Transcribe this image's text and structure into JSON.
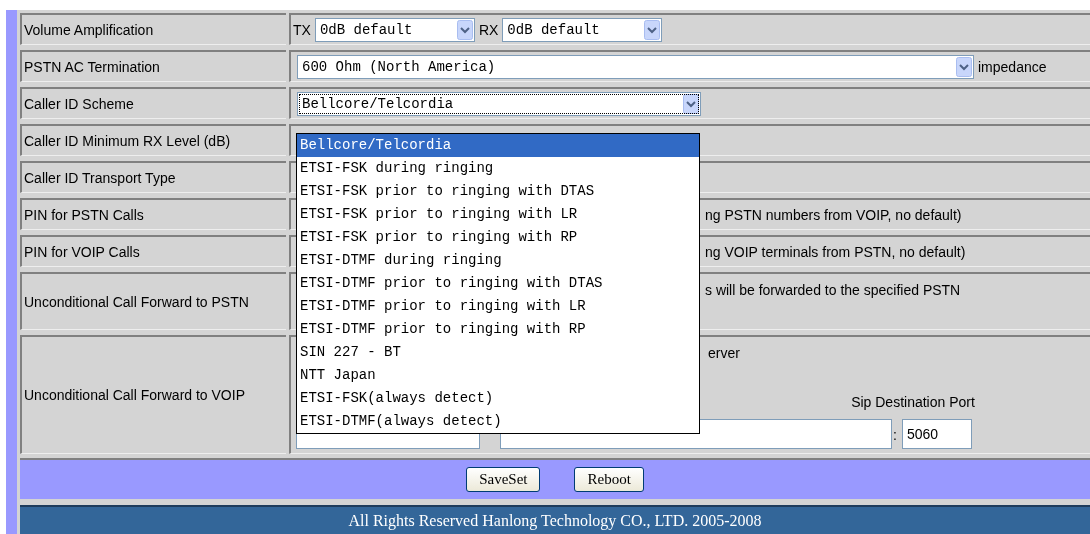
{
  "rows": [
    {
      "kind": "dual_select",
      "label": "Volume Amplification",
      "tx_label": "TX",
      "tx_value": "0dB default",
      "rx_label": "RX",
      "rx_value": "0dB default"
    },
    {
      "kind": "select_unit",
      "label": "PSTN AC Termination",
      "value": "600 Ohm (North America)",
      "unit": "impedance"
    },
    {
      "kind": "select_open",
      "label": "Caller ID Scheme",
      "value": "Bellcore/Telcordia"
    },
    {
      "kind": "blank",
      "label": "Caller ID Minimum RX Level (dB)"
    },
    {
      "kind": "blank",
      "label": "Caller ID Transport Type"
    },
    {
      "kind": "note",
      "label": "PIN for PSTN Calls",
      "note": "ng PSTN numbers from VOIP, no default)"
    },
    {
      "kind": "note",
      "label": "PIN for VOIP Calls",
      "note": "ng VOIP terminals from PSTN, no default)"
    },
    {
      "kind": "note_tall",
      "label": "Unconditional Call Forward to PSTN",
      "note": "s will be forwarded to the specified PSTN"
    },
    {
      "kind": "voip_forward",
      "label": "Unconditional Call Forward to VOIP",
      "server_label": "erver",
      "port_label": "Sip Destination Port",
      "separator": ":",
      "port_value": "5060"
    }
  ],
  "dropdown": {
    "options": [
      {
        "label": "Bellcore/Telcordia",
        "selected": true
      },
      {
        "label": "ETSI-FSK during ringing",
        "selected": false
      },
      {
        "label": "ETSI-FSK prior to ringing with DTAS",
        "selected": false
      },
      {
        "label": "ETSI-FSK prior to ringing with LR",
        "selected": false
      },
      {
        "label": "ETSI-FSK prior to ringing with RP",
        "selected": false
      },
      {
        "label": "ETSI-DTMF during ringing",
        "selected": false
      },
      {
        "label": "ETSI-DTMF prior to ringing with DTAS",
        "selected": false
      },
      {
        "label": "ETSI-DTMF prior to ringing with LR",
        "selected": false
      },
      {
        "label": "ETSI-DTMF prior to ringing with RP",
        "selected": false
      },
      {
        "label": "SIN 227 - BT",
        "selected": false
      },
      {
        "label": "NTT Japan",
        "selected": false
      },
      {
        "label": "ETSI-FSK(always detect)",
        "selected": false
      },
      {
        "label": "ETSI-DTMF(always detect)",
        "selected": false
      }
    ]
  },
  "buttons": [
    "SaveSet",
    "Reboot"
  ],
  "footer": "All Rights Reserved Hanlong Technology CO., LTD. 2005-2008"
}
